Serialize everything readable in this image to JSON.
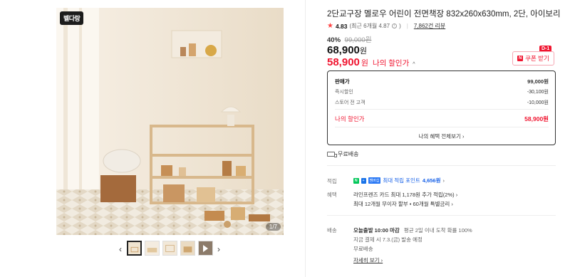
{
  "gallery": {
    "brand_badge": "벨다랑",
    "photo_counter": "1/7",
    "prev_icon": "chevron-left-icon",
    "next_icon": "chevron-right-icon",
    "thumbnail_count": 5,
    "active_thumbnail": 1,
    "video_thumbnail": 5
  },
  "product": {
    "title": "2단교구장 멜로우 어린이 전면책장 832x260x630mm, 2단, 아이보리",
    "rating": "4.83",
    "rating_recent": "(최근 6개월 4.87",
    "rating_recent_close": ")",
    "review_count": "7,862건 리뷰",
    "discount_rate": "40%",
    "original_price": "99,000원",
    "price": "68,900",
    "won": "원",
    "my_price": "58,900",
    "my_won": "원",
    "my_price_label": "나의 할인가",
    "caret": "^"
  },
  "coupon": {
    "dday": "D-1",
    "logo": "N",
    "label": "쿠폰 받기"
  },
  "price_box": {
    "sale_label": "판매가",
    "sale_value": "99,000원",
    "instant_label": "즉시할인",
    "instant_value": "-30,100원",
    "store_label": "스토어 전 고객",
    "store_value": "-10,000원",
    "my_label": "나의 할인가",
    "my_value": "58,900원",
    "benefits_link": "나의 혜택 전체보기 ›"
  },
  "shipping_badge": "무료배송",
  "points": {
    "label": "적립",
    "npay": "N",
    "plus": "+",
    "membership": "멤버십",
    "text": "최대 적립 포인트 ",
    "amount": "4,656원",
    "chevron": "›"
  },
  "benefits": {
    "label": "혜택",
    "line1": "라인프렌즈 카드 최대 1,178원 추가 적립(2%) ›",
    "line2": "최대 12개월 무이자 할부 • 60개월 특별금리 ›"
  },
  "delivery": {
    "label": "배송",
    "today_label": "오늘출발 10:00 마감",
    "today_desc": "평균 2일 이내 도착 확률 100%",
    "pay_now": "지금 결제 시 7.3.(금) 발송 예정",
    "fee": "무료배송",
    "more": "자세히 보기 ›"
  },
  "colors": {
    "accent_red": "#f0142f",
    "link_blue": "#1761e8",
    "npay_green": "#03c75a"
  }
}
